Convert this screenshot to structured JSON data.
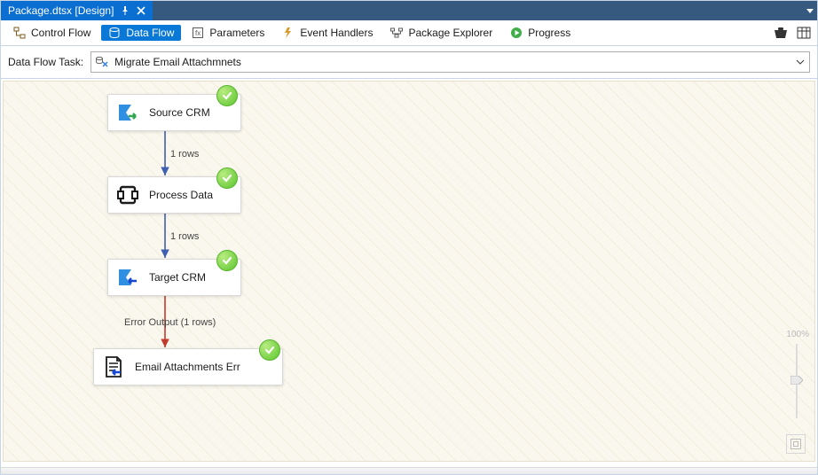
{
  "title_tab": {
    "label": "Package.dtsx [Design]"
  },
  "tabs": {
    "control_flow": "Control Flow",
    "data_flow": "Data Flow",
    "parameters": "Parameters",
    "event_handlers": "Event Handlers",
    "package_explorer": "Package Explorer",
    "progress": "Progress"
  },
  "task_row": {
    "label": "Data Flow Task:",
    "value": "Migrate Email Attachmnets"
  },
  "nodes": {
    "source": {
      "label": "Source CRM"
    },
    "process": {
      "label": "Process Data"
    },
    "target": {
      "label": "Target CRM"
    },
    "err": {
      "label": "Email Attachments Err"
    }
  },
  "links": {
    "l1": "1 rows",
    "l2": "1 rows",
    "l3": "Error Output (1 rows)"
  },
  "zoom": {
    "label": "100%"
  }
}
